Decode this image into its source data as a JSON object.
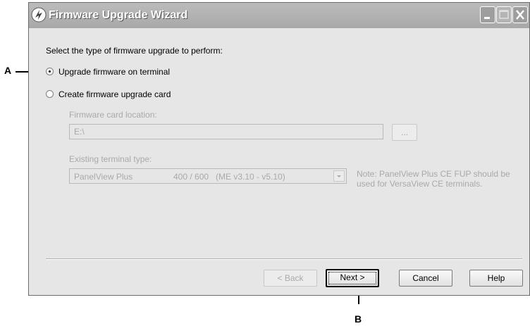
{
  "window": {
    "title": "Firmware Upgrade Wizard"
  },
  "prompt": "Select the type of firmware upgrade to perform:",
  "options": [
    {
      "label": "Upgrade firmware on terminal",
      "selected": true
    },
    {
      "label": "Create firmware upgrade card",
      "selected": false
    }
  ],
  "card_location": {
    "label": "Firmware card location:",
    "value": "E:\\",
    "browse_label": "..."
  },
  "terminal_type": {
    "label": "Existing terminal type:",
    "model": "PanelView Plus",
    "size": "400 / 600",
    "version": "(ME v3.10 - v5.10)",
    "note": "Note: PanelView Plus CE FUP should be used for VersaView CE terminals."
  },
  "buttons": {
    "back": "< Back",
    "next": "Next >",
    "cancel": "Cancel",
    "help": "Help"
  },
  "callouts": {
    "a": "A",
    "b": "B"
  },
  "colors": {
    "titlebar": "#a8a8a8",
    "dialog_bg": "#e6e6e6",
    "disabled_text": "#a9a9a9"
  }
}
